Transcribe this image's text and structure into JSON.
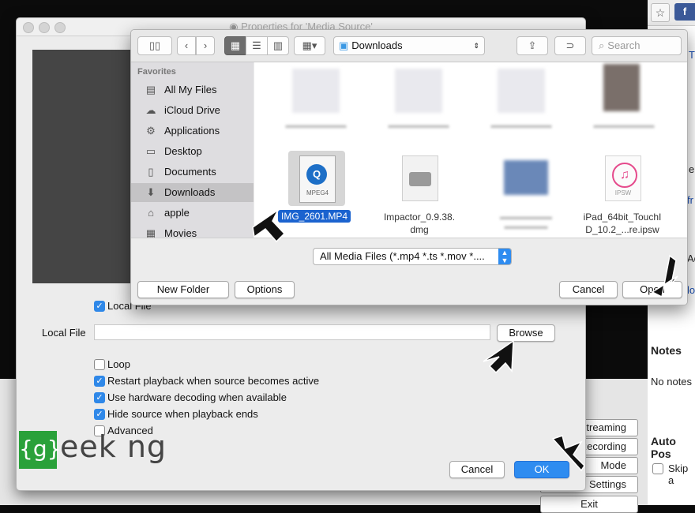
{
  "browser": {
    "star": "☆",
    "fb": "f",
    "side_text": [
      "T",
      "e",
      "fr",
      "Ac",
      "lo",
      "Notes",
      "No notes",
      "Auto Pos",
      "Skip a"
    ]
  },
  "obs": {
    "buttons": [
      "Streaming",
      "Recording",
      "Mode",
      "Settings",
      "Exit"
    ]
  },
  "properties": {
    "title": "Properties for 'Media Source'",
    "local_file_check": "Local File",
    "local_file_label": "Local File",
    "browse": "Browse",
    "options": [
      {
        "label": "Loop",
        "checked": false
      },
      {
        "label": "Restart playback when source becomes active",
        "checked": true
      },
      {
        "label": "Use hardware decoding when available",
        "checked": true
      },
      {
        "label": "Hide source when playback ends",
        "checked": true
      },
      {
        "label": "Advanced",
        "checked": false
      }
    ],
    "cancel": "Cancel",
    "ok": "OK"
  },
  "logo": {
    "box": "{g}",
    "text": "eek ng"
  },
  "dialog": {
    "location": "Downloads",
    "search_placeholder": "Search",
    "favorites_header": "Favorites",
    "sidebar": [
      {
        "label": "All My Files",
        "icon": "all-files-icon",
        "glyph": "▤"
      },
      {
        "label": "iCloud Drive",
        "icon": "cloud-icon",
        "glyph": "☁"
      },
      {
        "label": "Applications",
        "icon": "applications-icon",
        "glyph": "⚙"
      },
      {
        "label": "Desktop",
        "icon": "desktop-icon",
        "glyph": "▭"
      },
      {
        "label": "Documents",
        "icon": "documents-icon",
        "glyph": "▯"
      },
      {
        "label": "Downloads",
        "icon": "downloads-icon",
        "glyph": "⬇"
      },
      {
        "label": "apple",
        "icon": "home-icon",
        "glyph": "⌂"
      },
      {
        "label": "Movies",
        "icon": "movies-icon",
        "glyph": "▦"
      }
    ],
    "files": [
      {
        "name": "IMG_2601.MP4",
        "selected": true
      },
      {
        "name": "Impactor_0.9.38.\ndmg"
      },
      {
        "name": "iPad_64bit_TouchI\nD_10.2_...re.ipsw"
      }
    ],
    "filter": "All Media Files (*.mp4 *.ts *.mov *....",
    "new_folder": "New Folder",
    "options": "Options",
    "cancel": "Cancel",
    "open": "Open"
  }
}
